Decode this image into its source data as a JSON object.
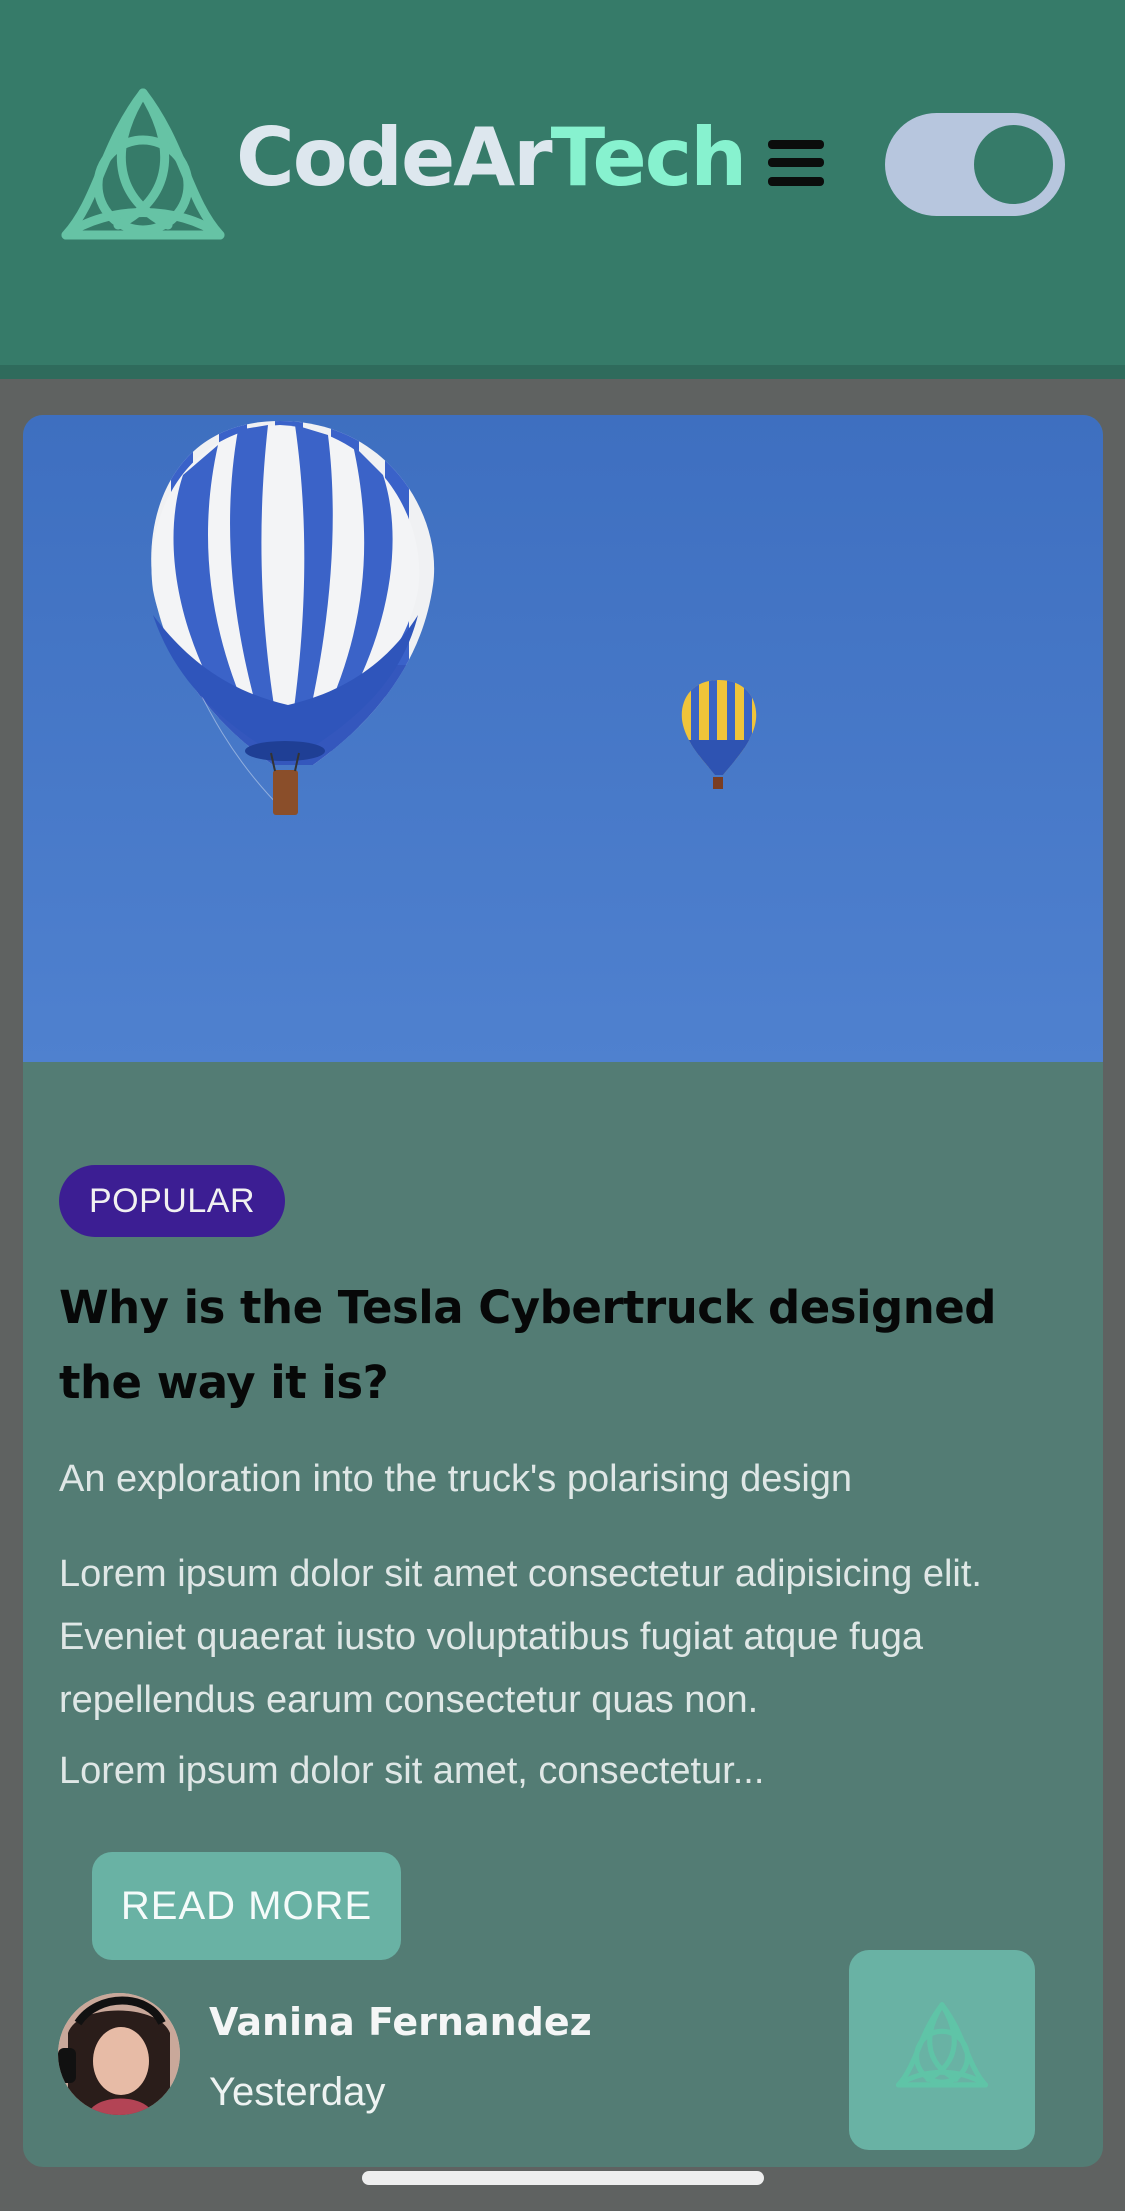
{
  "header": {
    "brand_part1": "CodeAr",
    "brand_part2": "Tech",
    "logo_icon": "triquetra-icon",
    "menu_icon": "hamburger-menu-icon",
    "theme_toggle_state": "on"
  },
  "article": {
    "image_icon": "hot-air-balloons-image",
    "badge": "POPULAR",
    "title": "Why is the Tesla Cybertruck designed the way it is?",
    "subtitle": "An exploration into the truck's polarising design",
    "body": "Lorem ipsum dolor sit amet consectetur adipisicing elit. Eveniet quaerat iusto voluptatibus fugiat atque fuga repellendus earum consectetur quas non.",
    "excerpt": "Lorem ipsum dolor sit amet, consectetur...",
    "read_more_label": "READ MORE",
    "author_name": "Vanina Fernandez",
    "date": "Yesterday"
  },
  "colors": {
    "header_bg": "#367b69",
    "brand_accent": "#87f2cf",
    "card_bg": "#537c74",
    "badge_bg": "#3c1e93",
    "button_bg": "#69b2a4"
  }
}
